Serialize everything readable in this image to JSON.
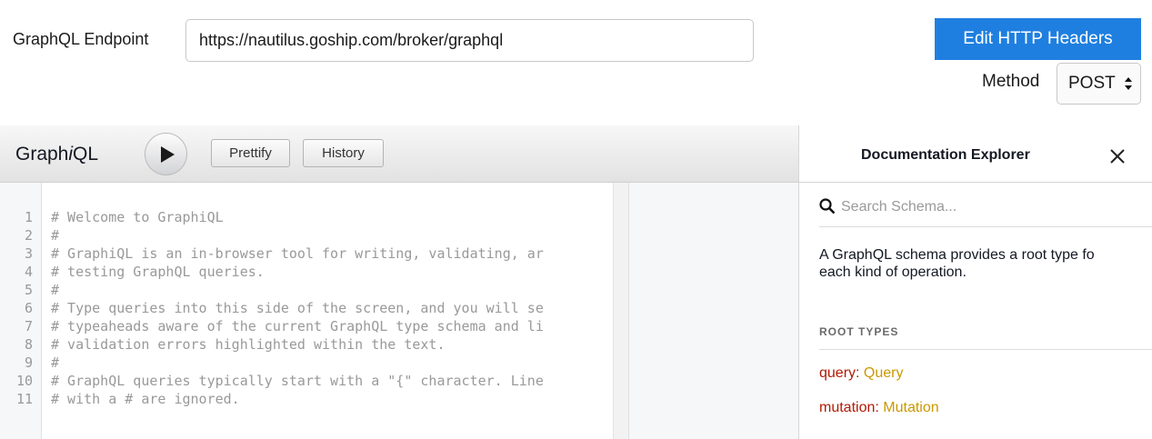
{
  "endpoint": {
    "label": "GraphQL Endpoint",
    "value": "https://nautilus.goship.com/broker/graphql"
  },
  "headers_button": {
    "label": "Edit HTTP Headers"
  },
  "method": {
    "label": "Method",
    "value": "POST"
  },
  "toolbar": {
    "logo_prefix": "Graph",
    "logo_italic": "i",
    "logo_suffix": "QL",
    "run_icon": "play-icon",
    "prettify_label": "Prettify",
    "history_label": "History"
  },
  "editor": {
    "lines": [
      {
        "no": "1",
        "text": "# Welcome to GraphiQL"
      },
      {
        "no": "2",
        "text": "#"
      },
      {
        "no": "3",
        "text": "# GraphiQL is an in-browser tool for writing, validating, ar"
      },
      {
        "no": "4",
        "text": "# testing GraphQL queries."
      },
      {
        "no": "5",
        "text": "#"
      },
      {
        "no": "6",
        "text": "# Type queries into this side of the screen, and you will se"
      },
      {
        "no": "7",
        "text": "# typeaheads aware of the current GraphQL type schema and li"
      },
      {
        "no": "8",
        "text": "# validation errors highlighted within the text."
      },
      {
        "no": "9",
        "text": "#"
      },
      {
        "no": "10",
        "text": "# GraphQL queries typically start with a \"{\" character. Line"
      },
      {
        "no": "11",
        "text": "# with a # are ignored."
      }
    ]
  },
  "docs": {
    "title": "Documentation Explorer",
    "close_icon": "close-icon",
    "search_icon": "search-icon",
    "search_placeholder": "Search Schema...",
    "description_line1": "A GraphQL schema provides a root type fo",
    "description_line2": "each kind of operation.",
    "section_title": "ROOT TYPES",
    "root_types": [
      {
        "field": "query",
        "type": "Query"
      },
      {
        "field": "mutation",
        "type": "Mutation"
      }
    ],
    "colors": {
      "field": "#b11a04",
      "type": "#ca9800",
      "accent": "#1f7fe0"
    }
  }
}
